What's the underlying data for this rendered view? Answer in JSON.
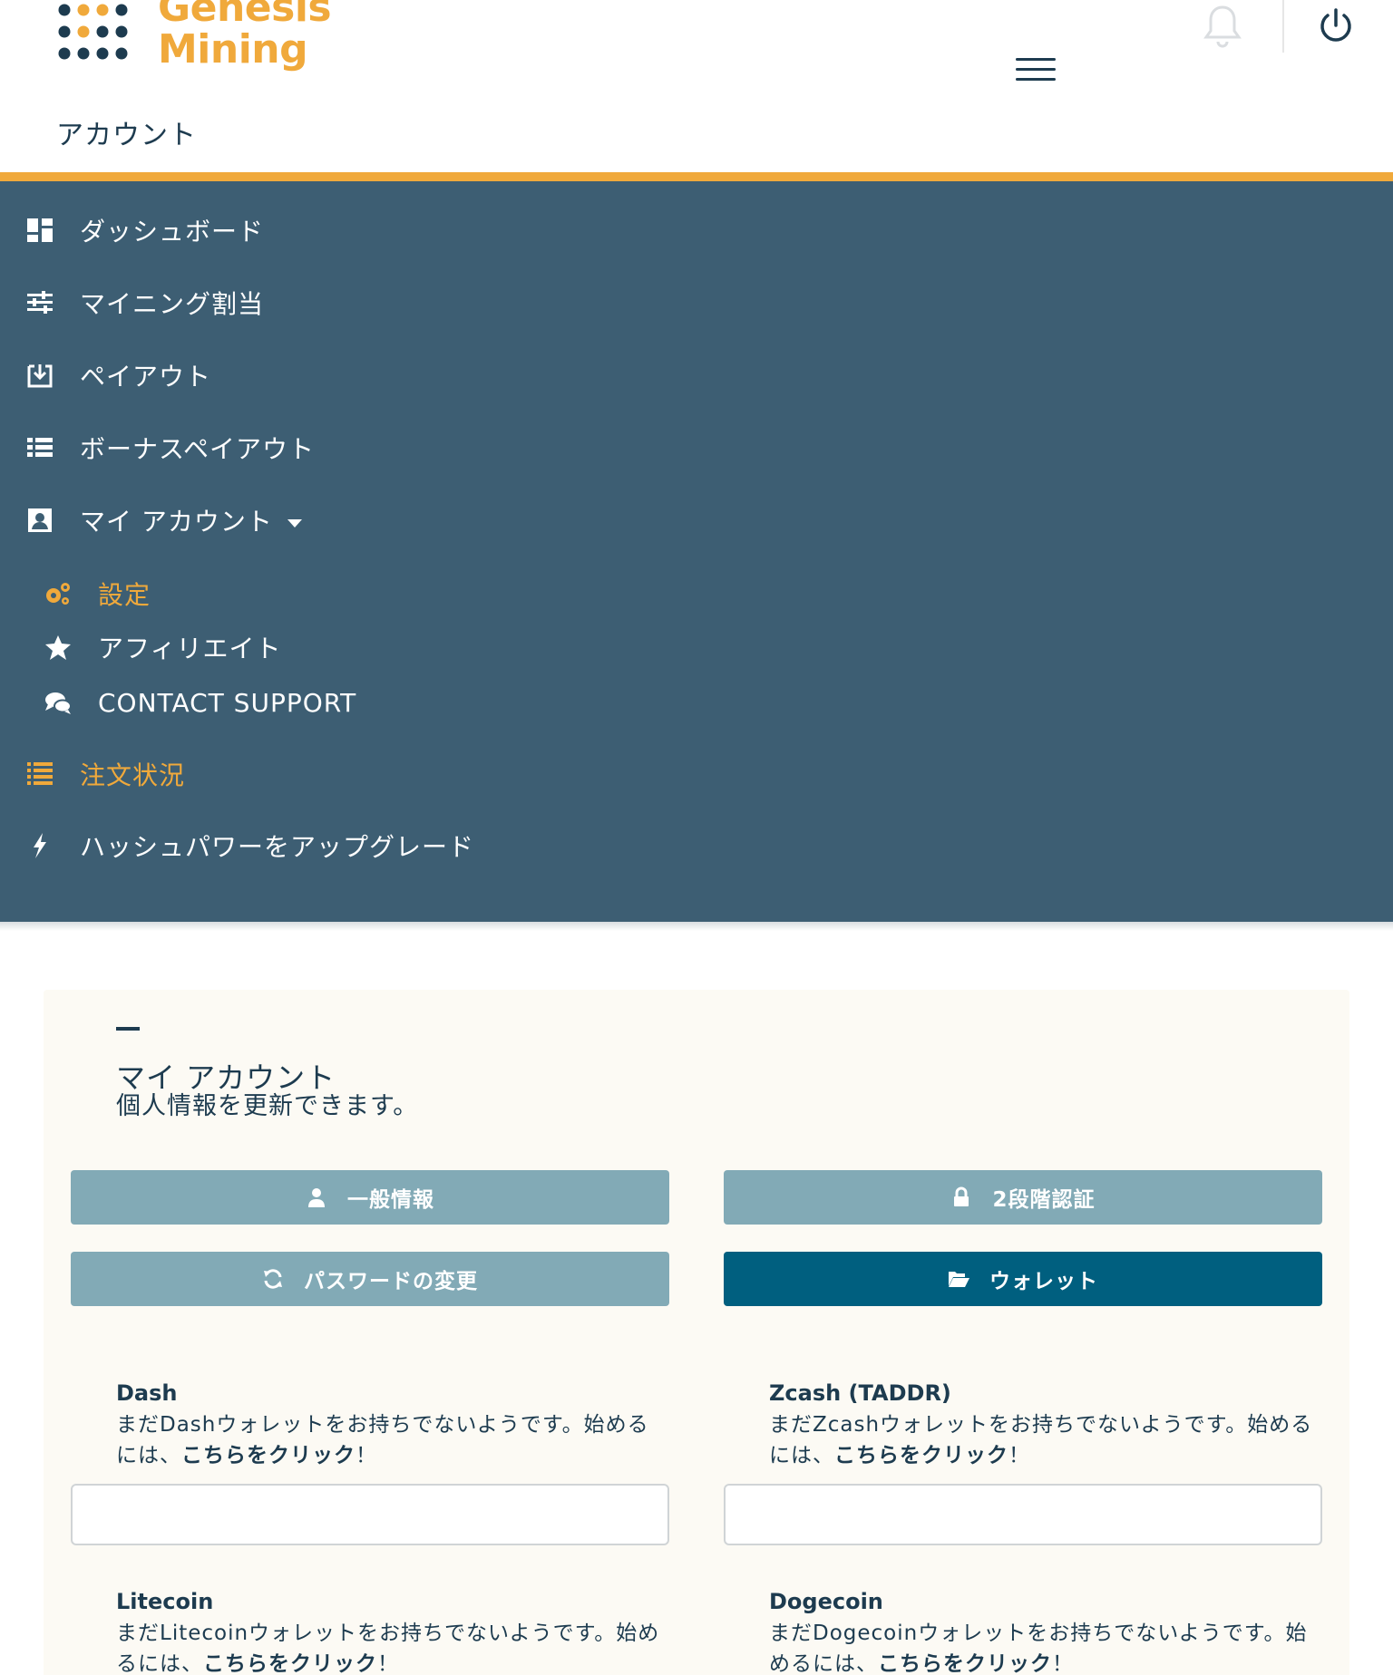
{
  "brand": {
    "line1": "Genesis",
    "line2": "Mining",
    "accent": "#f0a93b",
    "dark": "#1d3b4f"
  },
  "header": {
    "page_label": "アカウント"
  },
  "nav": {
    "background": "#3d5e73",
    "items": [
      {
        "label": "ダッシュボード",
        "icon": "dashboard-icon"
      },
      {
        "label": "マイニング割当",
        "icon": "sliders-icon"
      },
      {
        "label": "ペイアウト",
        "icon": "download-icon"
      },
      {
        "label": "ボーナスペイアウト",
        "icon": "list-icon"
      },
      {
        "label": "マイ アカウント",
        "icon": "account-icon"
      },
      {
        "label": "設定",
        "icon": "gears-icon"
      },
      {
        "label": "アフィリエイト",
        "icon": "star-icon"
      },
      {
        "label": "CONTACT SUPPORT",
        "icon": "chat-icon"
      },
      {
        "label": "注文状況",
        "icon": "ordered-list-icon"
      },
      {
        "label": "ハッシュパワーをアップグレード",
        "icon": "bolt-icon"
      }
    ]
  },
  "card": {
    "title": "マイ アカウント",
    "subtitle": "個人情報を更新できます。",
    "tabs": [
      {
        "label": "一般情報",
        "icon": "user-icon"
      },
      {
        "label": "2段階認証",
        "icon": "lock-icon"
      },
      {
        "label": "パスワードの変更",
        "icon": "refresh-icon"
      },
      {
        "label": "ウォレット",
        "icon": "folder-open-icon"
      }
    ],
    "wallets": [
      {
        "name": "Dash",
        "desc": "まだDashウォレットをお持ちでないようです。始めるには、",
        "link": "こちらをクリック",
        "suffix": "！",
        "value": ""
      },
      {
        "name": "Zcash (TADDR)",
        "desc": "まだZcashウォレットをお持ちでないようです。始めるには、",
        "link": "こちらをクリック",
        "suffix": "！",
        "value": ""
      },
      {
        "name": "Litecoin",
        "desc": "まだLitecoinウォレットをお持ちでないようです。始めるには、",
        "link": "こちらをクリック",
        "suffix": "！",
        "value": ""
      },
      {
        "name": "Dogecoin",
        "desc": "まだDogecoinウォレットをお持ちでないようです。始めるには、",
        "link": "こちらをクリック",
        "suffix": "！",
        "value": ""
      }
    ]
  }
}
